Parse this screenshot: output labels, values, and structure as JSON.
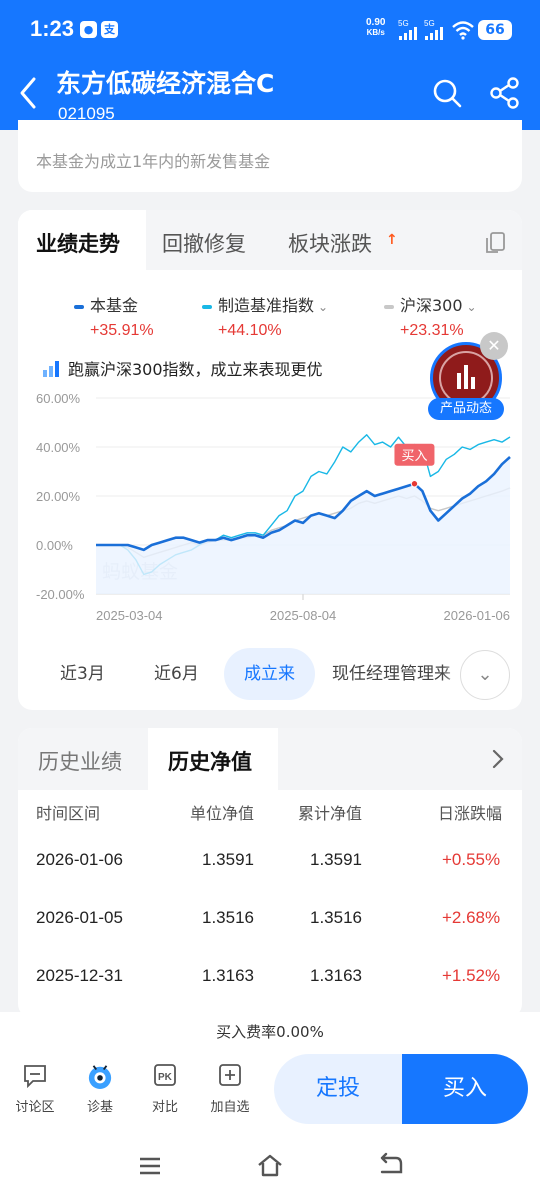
{
  "status_bar": {
    "time": "1:23",
    "net_speed": "0.90",
    "net_unit": "KB/s",
    "sim1": "5G",
    "sim2": "5G",
    "battery": "66",
    "app_icons": [
      "wechat-icon",
      "alipay-icon"
    ]
  },
  "header": {
    "title": "东方低碳经济混合C",
    "code": "021095"
  },
  "notice": "本基金为成立1年内的新发售基金",
  "performance": {
    "tabs": [
      "业绩走势",
      "回撤修复",
      "板块涨跌"
    ],
    "legend": [
      {
        "name": "本基金",
        "value": "+35.91%",
        "color": "#1a6fd8",
        "dropdown": false
      },
      {
        "name": "制造基准指数",
        "value": "+44.10%",
        "color": "#19b8e6",
        "dropdown": true
      },
      {
        "name": "沪深300",
        "value": "+23.31%",
        "color": "#c8c8c8",
        "dropdown": true
      }
    ],
    "tip": "跑赢沪深300指数，成立来表现更优",
    "promo_label": "产品动态",
    "buy_marker": "买入",
    "watermark": "蚂蚁基金",
    "ranges": [
      "近3月",
      "近6月",
      "成立来",
      "现任经理管理来"
    ],
    "active_range": "成立来"
  },
  "chart_data": {
    "type": "line",
    "y_ticks": [
      "60.00%",
      "40.00%",
      "20.00%",
      "0.00%",
      "-20.00%"
    ],
    "ylim": [
      -20,
      60
    ],
    "x_ticks": [
      "2025-03-04",
      "2025-08-04",
      "2026-01-06"
    ],
    "series": [
      {
        "name": "本基金",
        "color": "#1a6fd8",
        "values": [
          0,
          0,
          0,
          0,
          0,
          -1,
          -2,
          0,
          1,
          2,
          3,
          3,
          2,
          1,
          2,
          2,
          3,
          2,
          3,
          4,
          4,
          3,
          5,
          6,
          8,
          10,
          9,
          12,
          13,
          12,
          11,
          14,
          18,
          20,
          22,
          20,
          21,
          22,
          23,
          24,
          25,
          22,
          14,
          10,
          13,
          16,
          19,
          21,
          24,
          26,
          29,
          33,
          35.91
        ]
      },
      {
        "name": "制造基准指数",
        "color": "#19b8e6",
        "values": [
          0,
          0,
          0,
          0,
          -2,
          -6,
          -12,
          -11,
          -8,
          -6,
          -4,
          -3,
          -2,
          0,
          2,
          2,
          4,
          3,
          4,
          5,
          5,
          4,
          8,
          12,
          14,
          20,
          22,
          28,
          30,
          29,
          34,
          40,
          38,
          42,
          45,
          41,
          42,
          40,
          44,
          40,
          41,
          40,
          28,
          30,
          35,
          37,
          40,
          39,
          41,
          42,
          43,
          42,
          44.1
        ]
      },
      {
        "name": "沪深300",
        "color": "#c8c8c8",
        "values": [
          0,
          0,
          0,
          0,
          -1,
          -3,
          -5,
          -4,
          -3,
          -2,
          -1,
          0,
          1,
          0,
          1,
          2,
          2,
          2,
          3,
          3,
          4,
          4,
          6,
          7,
          8,
          10,
          11,
          12,
          13,
          12,
          13,
          14,
          15,
          17,
          18,
          17,
          18,
          19,
          20,
          19,
          20,
          18,
          15,
          14,
          15,
          16,
          17,
          18,
          19,
          20,
          21,
          22,
          23.31
        ]
      }
    ],
    "xlabel": "",
    "ylabel": "",
    "grid": true,
    "legend_placement": "top"
  },
  "history": {
    "tabs": [
      "历史业绩",
      "历史净值"
    ],
    "active_tab": "历史净值",
    "columns": [
      "时间区间",
      "单位净值",
      "累计净值",
      "日涨跌幅"
    ],
    "rows": [
      {
        "date": "2026-01-06",
        "nav": "1.3591",
        "acc_nav": "1.3591",
        "change": "+0.55%"
      },
      {
        "date": "2026-01-05",
        "nav": "1.3516",
        "acc_nav": "1.3516",
        "change": "+2.68%"
      },
      {
        "date": "2025-12-31",
        "nav": "1.3163",
        "acc_nav": "1.3163",
        "change": "+1.52%"
      }
    ]
  },
  "bottom": {
    "fee_text": "买入费率0.00%",
    "actions": [
      "讨论区",
      "诊基",
      "对比",
      "加自选"
    ],
    "plan_label": "定投",
    "buy_label": "买入"
  }
}
